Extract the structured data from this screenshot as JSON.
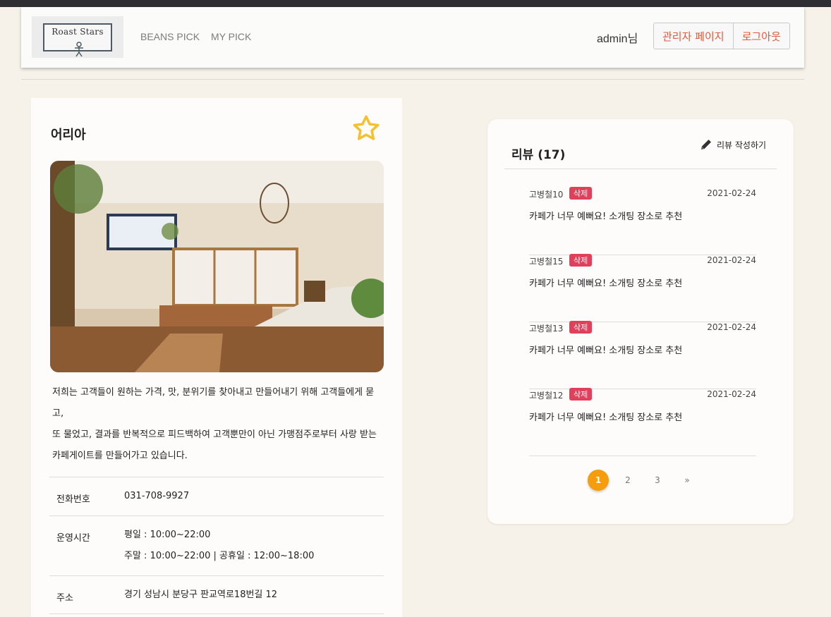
{
  "header": {
    "logo_text": "Roast Stars",
    "nav": [
      "BEANS PICK",
      "MY PICK"
    ],
    "user_greeting": "admin님",
    "admin_button": "관리자 페이지",
    "logout_button": "로그아웃"
  },
  "cafe": {
    "name": "어리아",
    "favorite_icon": "star-outline-icon",
    "description_lines": [
      "저희는 고객들이 원하는 가격, 맛, 분위기를 찾아내고 만들어내기 위해 고객들에게 묻",
      "고,",
      "또 물었고, 결과를 반복적으로 피드백하여 고객뿐만이 아닌 가맹점주로부터 사랑 받는",
      "카페게이트를 만들어가고 있습니다."
    ],
    "info": {
      "phone_label": "전화번호",
      "phone": "031-708-9927",
      "hours_label": "운영시간",
      "hours_weekday": "평일 : 10:00~22:00",
      "hours_weekend": "주말 : 10:00~22:00 | 공휴일 : 12:00~18:00",
      "address_label": "주소",
      "address": "경기 성남시 분당구 판교역로18번길 12"
    }
  },
  "reviews": {
    "title": "리뷰 (17)",
    "write_label": "리뷰 작성하기",
    "items": [
      {
        "author": "고병철10",
        "delete": "삭제",
        "date": "2021-02-24",
        "text": "카페가 너무 예뻐요! 소개팅 장소로 추천"
      },
      {
        "author": "고병철15",
        "delete": "삭제",
        "date": "2021-02-24",
        "text": "카페가 너무 예뻐요! 소개팅 장소로 추천"
      },
      {
        "author": "고병철13",
        "delete": "삭제",
        "date": "2021-02-24",
        "text": "카페가 너무 예뻐요! 소개팅 장소로 추천"
      },
      {
        "author": "고병철12",
        "delete": "삭제",
        "date": "2021-02-24",
        "text": "카페가 너무 예뻐요! 소개팅 장소로 추천"
      }
    ],
    "pagination": [
      "1",
      "2",
      "3",
      "»"
    ],
    "active_page": "1"
  },
  "colors": {
    "accent_orange": "#f59d0c",
    "delete_red": "#e0405a",
    "header_button_text": "#e05a3c",
    "star_yellow": "#f5c02e"
  }
}
